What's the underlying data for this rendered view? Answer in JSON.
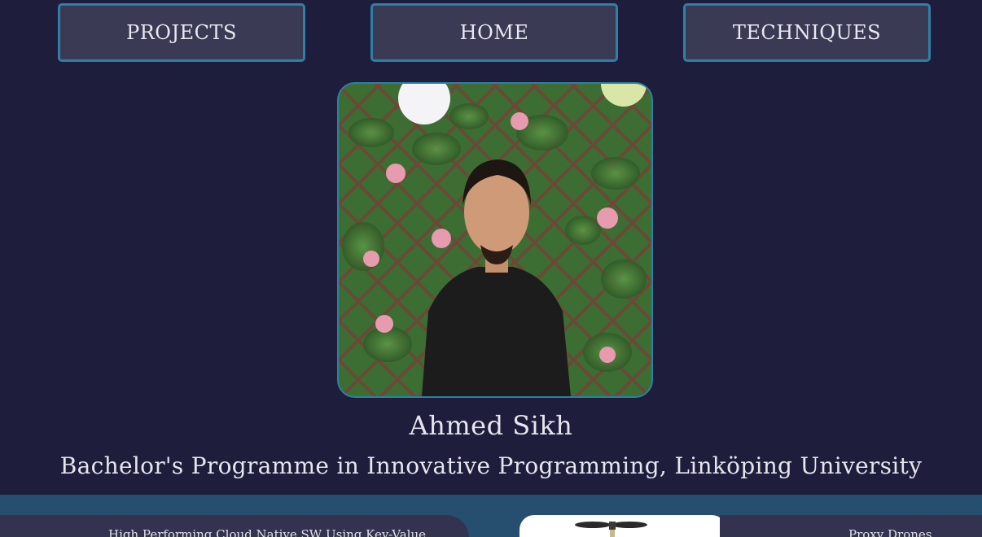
{
  "nav": {
    "projects_label": "PROJECTS",
    "home_label": "HOME",
    "techniques_label": "TECHNIQUES"
  },
  "profile": {
    "name": "Ahmed Sikh",
    "programme": "Bachelor's Programme in Innovative Programming, Linköping University"
  },
  "projects": {
    "card_1_title": "High Performing Cloud Native SW Using Key-Value",
    "card_3_title": "Proxy Drones"
  },
  "colors": {
    "background": "#1e1e3c",
    "button_fill": "#3a3a55",
    "button_border": "#2f7fa6",
    "band": "#264e6e",
    "card": "#33334f"
  }
}
